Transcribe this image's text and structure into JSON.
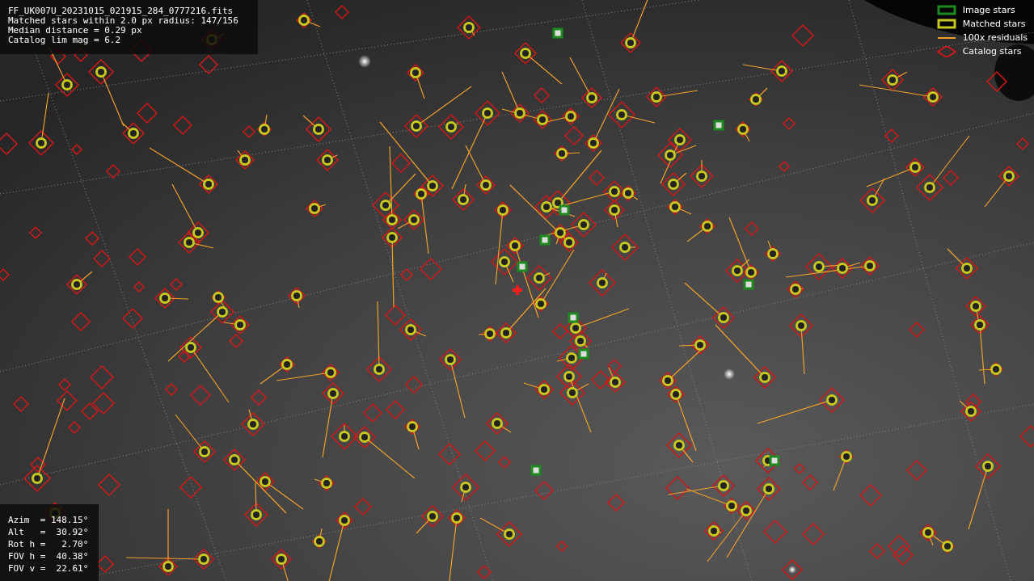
{
  "header": {
    "lines": [
      "FF_UK007U_20231015_021915_284_0777216.fits",
      "Matched stars within 2.0 px radius: 147/156",
      "Median distance = 0.29 px",
      "Catalog lim mag = 6.2"
    ]
  },
  "legend": [
    {
      "kind": "square",
      "color": "#1f8a1f",
      "label": "Image stars"
    },
    {
      "kind": "square",
      "color": "#c8c81e",
      "label": "Matched stars"
    },
    {
      "kind": "line",
      "color": "#f0a02a",
      "label": "100x residuals"
    },
    {
      "kind": "diamond",
      "color": "#d01818",
      "label": "Catalog stars"
    }
  ],
  "pointing": {
    "lines": [
      "Azim  = 148.15°",
      "Alt   =  30.92°",
      "Rot h =   2.70°",
      "FOV h =  40.38°",
      "FOV v =  22.61°"
    ]
  }
}
